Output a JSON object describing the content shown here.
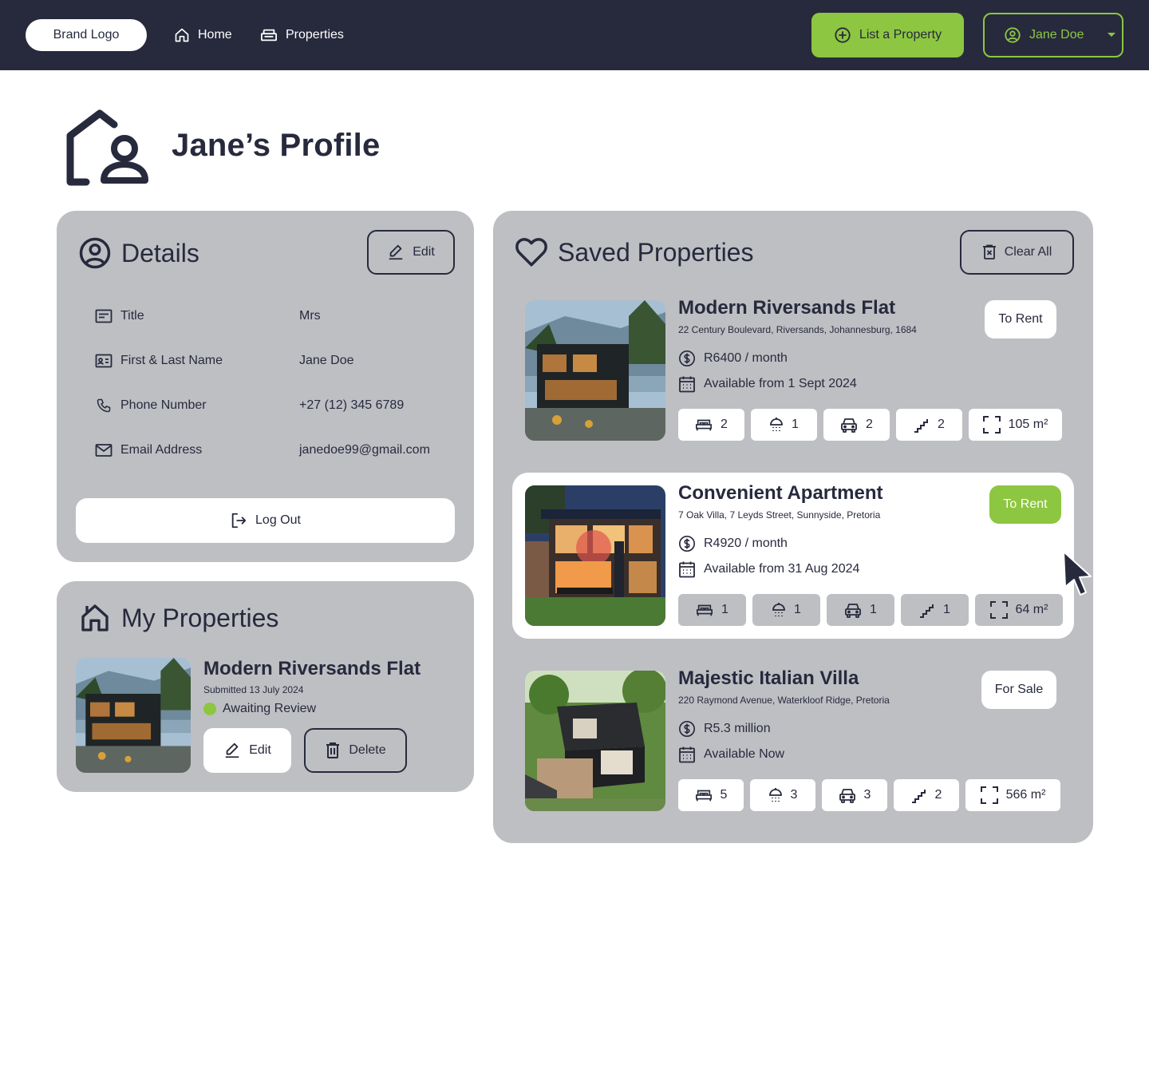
{
  "nav": {
    "brand": "Brand Logo",
    "home": "Home",
    "properties": "Properties",
    "list_property": "List a Property",
    "user": "Jane Doe"
  },
  "page": {
    "title": "Jane’s Profile"
  },
  "details": {
    "heading": "Details",
    "edit": "Edit",
    "rows": [
      {
        "label": "Title",
        "value": "Mrs"
      },
      {
        "label": "First & Last Name",
        "value": "Jane Doe"
      },
      {
        "label": "Phone Number",
        "value": "+27 (12) 345 6789"
      },
      {
        "label": "Email Address",
        "value": "janedoe99@gmail.com"
      }
    ],
    "logout": "Log Out"
  },
  "my_properties": {
    "heading": "My Properties",
    "item": {
      "title": "Modern Riversands Flat",
      "submitted": "Submitted 13 July 2024",
      "status": "Awaiting Review",
      "edit": "Edit",
      "delete": "Delete"
    }
  },
  "saved": {
    "heading": "Saved Properties",
    "clear_all": "Clear All",
    "cards": [
      {
        "title": "Modern Riversands Flat",
        "address": "22 Century Boulevard, Riversands, Johannesburg, 1684",
        "price": "R6400 / month",
        "availability": "Available from 1 Sept 2024",
        "badge": "To Rent",
        "beds": "2",
        "baths": "1",
        "garages": "2",
        "floors": "2",
        "area": "105 m²"
      },
      {
        "title": "Convenient Apartment",
        "address": "7 Oak Villa, 7 Leyds Street, Sunnyside, Pretoria",
        "price": "R4920 / month",
        "availability": "Available from 31 Aug 2024",
        "badge": "To Rent",
        "beds": "1",
        "baths": "1",
        "garages": "1",
        "floors": "1",
        "area": "64 m²"
      },
      {
        "title": "Majestic Italian Villa",
        "address": "220 Raymond Avenue, Waterkloof Ridge, Pretoria",
        "price": "R5.3 million",
        "availability": "Available Now",
        "badge": "For Sale",
        "beds": "5",
        "baths": "3",
        "garages": "3",
        "floors": "2",
        "area": "566 m²"
      }
    ]
  },
  "colors": {
    "navy": "#272a3d",
    "accent": "#8dc641",
    "panel": "#bebfc3",
    "white": "#ffffff"
  },
  "icons": [
    "home-icon",
    "sofa-icon",
    "plus-circle-icon",
    "user-circle-icon",
    "caret-down-icon",
    "house-user-icon",
    "pencil-icon",
    "id-card-icon",
    "phone-icon",
    "mail-icon",
    "logout-icon",
    "trash-icon",
    "heart-icon",
    "dollar-icon",
    "calendar-icon",
    "bed-icon",
    "shower-icon",
    "car-icon",
    "stairs-icon",
    "area-icon",
    "cursor-icon"
  ]
}
